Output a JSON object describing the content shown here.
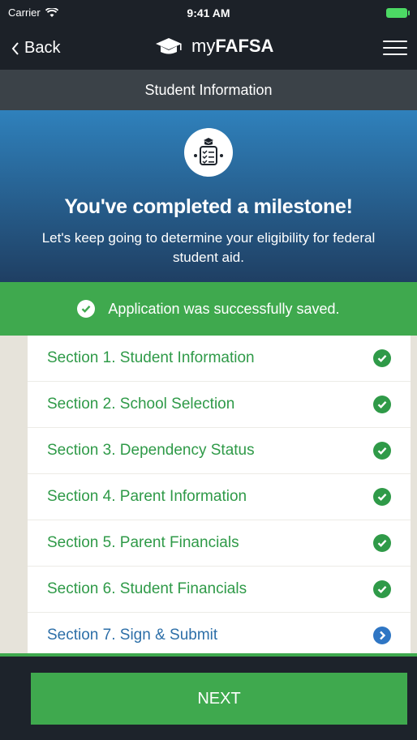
{
  "status_bar": {
    "carrier": "Carrier",
    "time": "9:41 AM"
  },
  "nav": {
    "back_label": "Back",
    "brand_light": "my",
    "brand_bold": "FAFSA"
  },
  "subheader": {
    "title": "Student Information"
  },
  "milestone": {
    "headline": "You've completed a milestone!",
    "message": "Let's keep going to determine your eligibility for federal student aid."
  },
  "success": {
    "message": "Application was successfully saved."
  },
  "sections": [
    {
      "label": "Section 1. Student Information",
      "status": "complete"
    },
    {
      "label": "Section 2. School Selection",
      "status": "complete"
    },
    {
      "label": "Section 3. Dependency Status",
      "status": "complete"
    },
    {
      "label": "Section 4. Parent Information",
      "status": "complete"
    },
    {
      "label": "Section 5. Parent Financials",
      "status": "complete"
    },
    {
      "label": "Section 6. Student Financials",
      "status": "complete"
    },
    {
      "label": "Section 7. Sign & Submit",
      "status": "current"
    }
  ],
  "footer": {
    "next_label": "NEXT"
  },
  "colors": {
    "accent_green": "#3fa94e",
    "current_blue": "#2f76c4",
    "header_dark": "#1c2128"
  },
  "icons": [
    "wifi-icon",
    "battery-icon",
    "chevron-left-icon",
    "graduation-cap-icon",
    "hamburger-menu-icon",
    "checklist-graduate-icon",
    "check-circle-icon",
    "chevron-right-circle-icon"
  ]
}
